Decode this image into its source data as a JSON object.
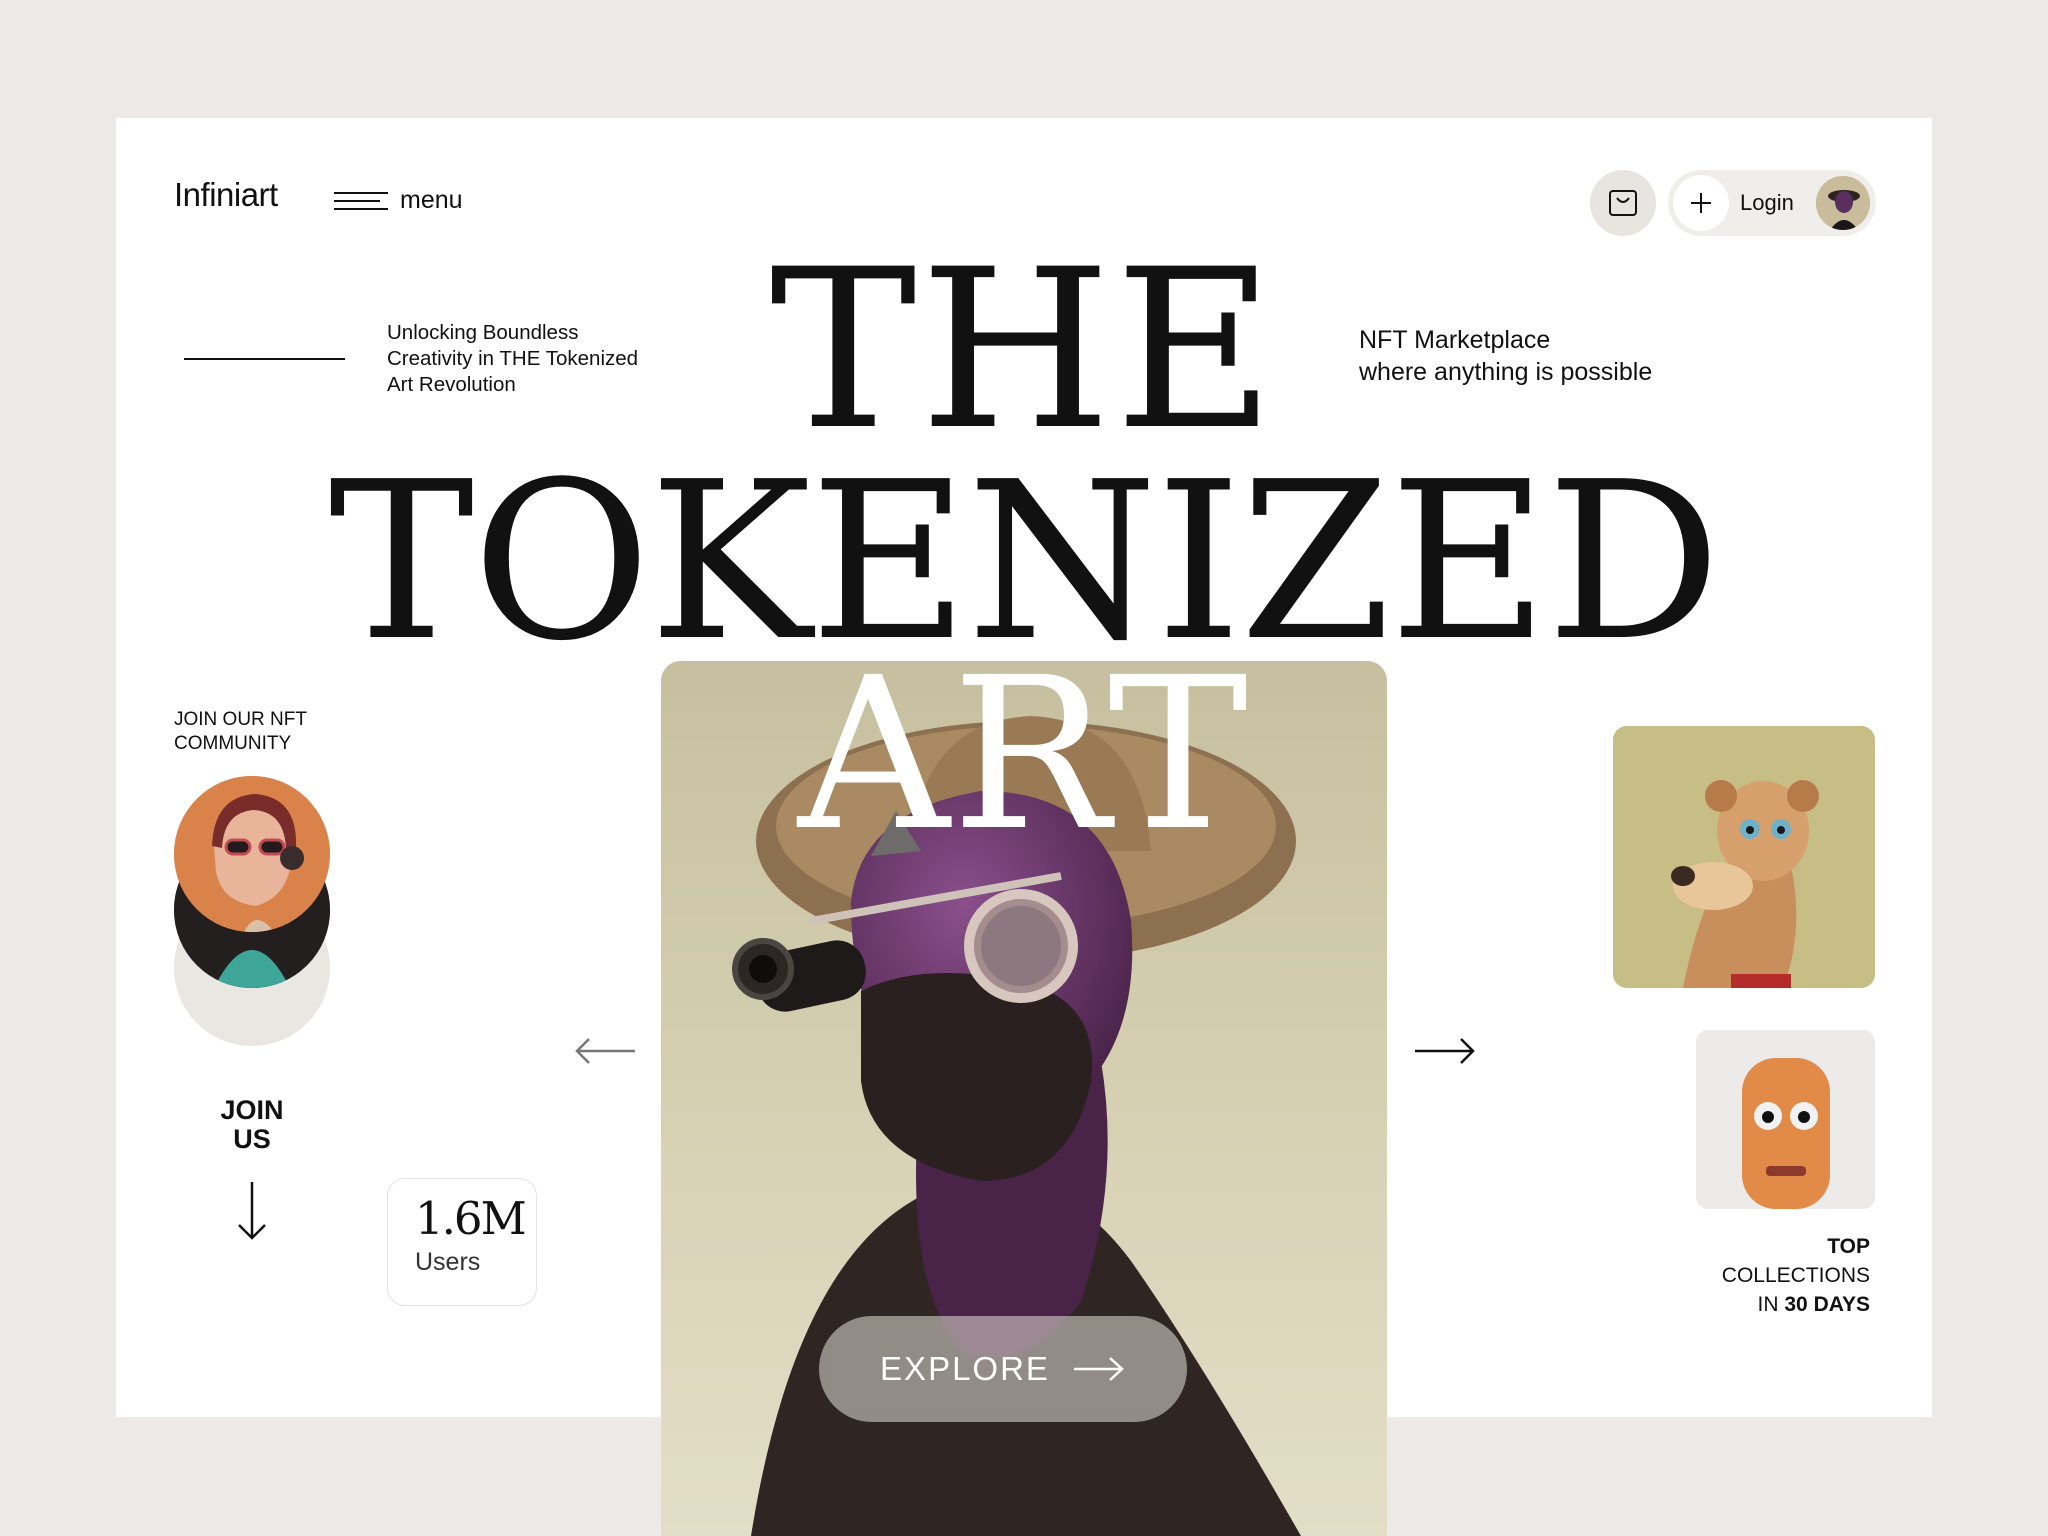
{
  "header": {
    "logo": "Infiniart",
    "menu_label": "menu",
    "login_label": "Login"
  },
  "intro": {
    "tagline_left": [
      "Unlocking Boundless",
      "Creativity in THE Tokenized",
      "Art Revolution"
    ],
    "tagline_right": [
      "NFT Marketplace",
      "where anything is possible"
    ]
  },
  "hero": {
    "line1": "THE",
    "line2": "TOKENIZED",
    "line3": "ART"
  },
  "community": {
    "title": [
      "JOIN OUR NFT",
      "COMMUNITY"
    ],
    "join_us": [
      "JOIN",
      "US"
    ]
  },
  "stats": {
    "users_count": "1.6M",
    "users_label": "Users"
  },
  "explore": {
    "label": "EXPLORE"
  },
  "collections": {
    "line1": "TOP",
    "line2": "COLLECTIONS",
    "line3_prefix": "IN ",
    "line3_bold": "30 DAYS"
  },
  "icons": [
    "menu-icon",
    "shopping-bag-icon",
    "plus-icon",
    "arrow-left-icon",
    "arrow-right-icon",
    "arrow-down-icon"
  ],
  "colors": {
    "background": "#ebeae6",
    "card": "#ffffff",
    "text": "#111111",
    "art_bg": "#d8d2b6",
    "accent_orange": "#d9834a"
  }
}
